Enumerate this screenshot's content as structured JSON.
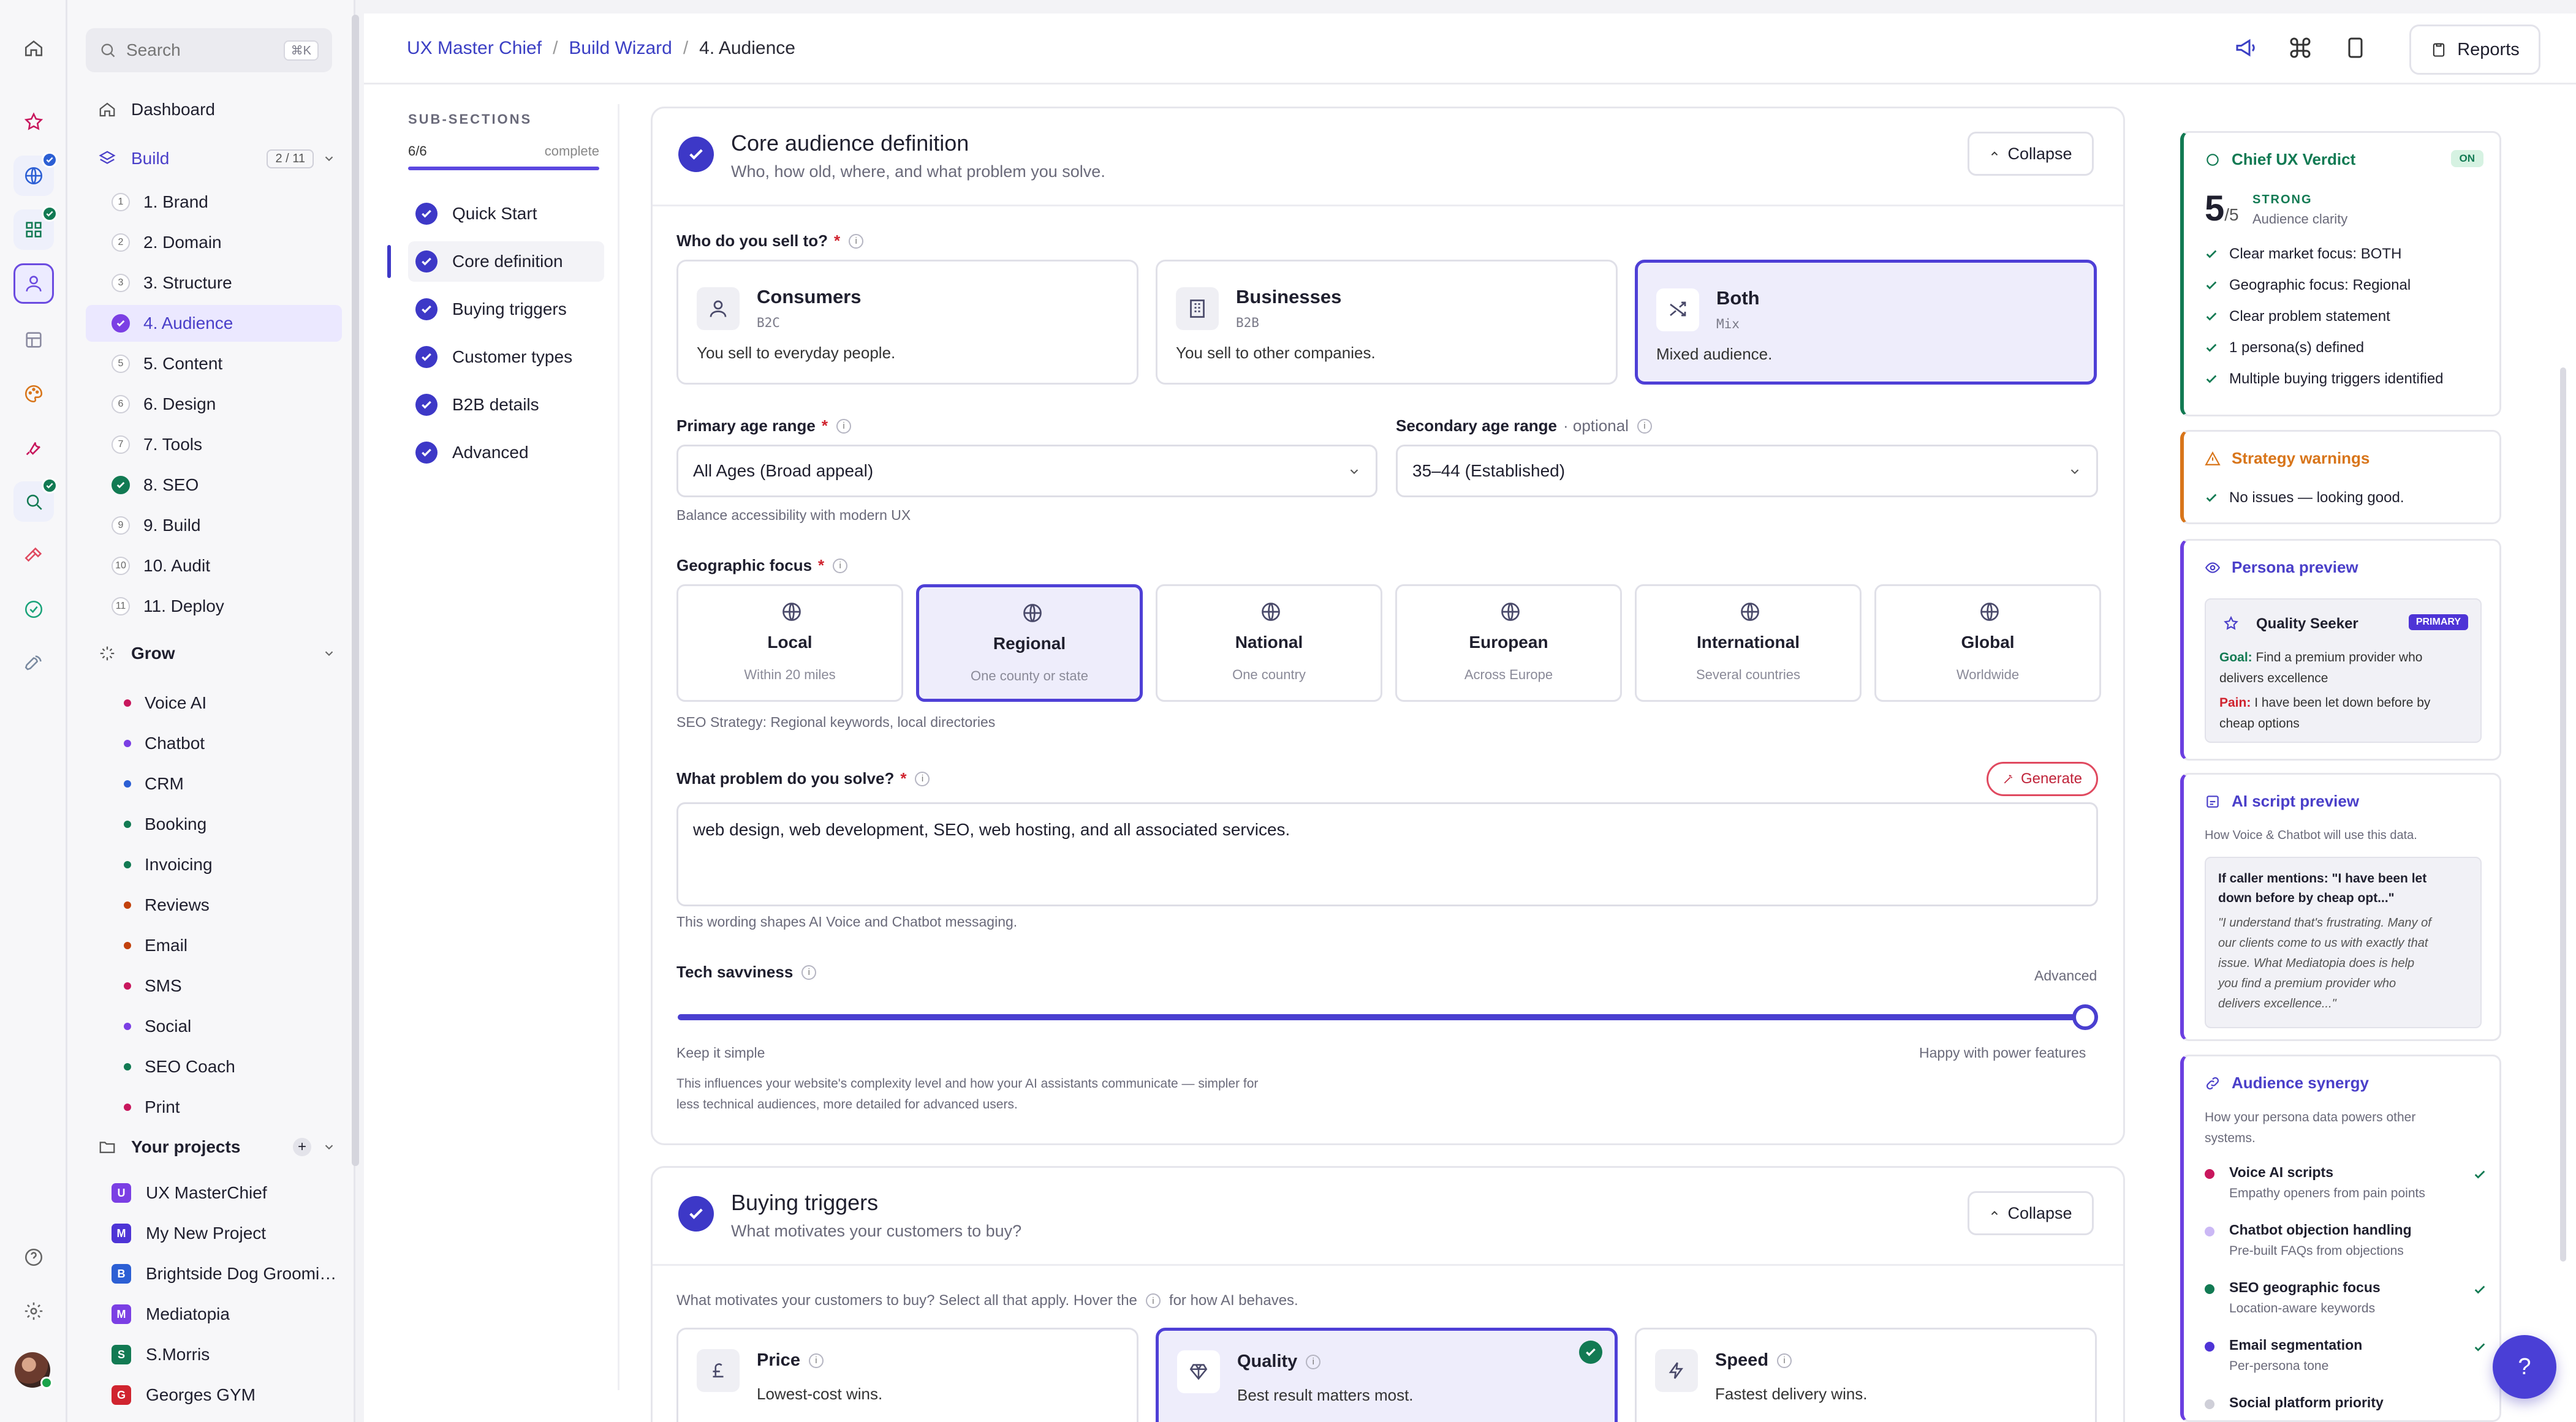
{
  "sidebar": {
    "search_placeholder": "Search",
    "search_shortcut": "⌘K",
    "dashboard": "Dashboard",
    "build_label": "Build",
    "build_progress": "2 / 11",
    "build_steps": [
      "1. Brand",
      "2. Domain",
      "3. Structure",
      "4. Audience",
      "5. Content",
      "6. Design",
      "7. Tools",
      "8. SEO",
      "9. Build",
      "10. Audit",
      "11. Deploy"
    ],
    "step_numbers": [
      "1",
      "2",
      "3",
      "4",
      "5",
      "6",
      "7",
      "8",
      "9",
      "10",
      "11"
    ],
    "grow_label": "Grow",
    "grow_items": [
      "Voice AI",
      "Chatbot",
      "CRM",
      "Booking",
      "Invoicing",
      "Reviews",
      "Email",
      "SMS",
      "Social",
      "SEO Coach",
      "Print"
    ],
    "grow_colors": [
      "#c8175d",
      "#7b3fe4",
      "#2c5fd4",
      "#127a53",
      "#127a53",
      "#c2410c",
      "#c2410c",
      "#c8175d",
      "#7b3fe4",
      "#127a53",
      "#c8175d"
    ],
    "projects_label": "Your projects",
    "projects": [
      {
        "initial": "U",
        "name": "UX MasterChief",
        "color": "#7b3fe4"
      },
      {
        "initial": "M",
        "name": "My New Project",
        "color": "#4e34d6"
      },
      {
        "initial": "B",
        "name": "Brightside Dog Groomi…",
        "color": "#2c5fd4"
      },
      {
        "initial": "M",
        "name": "Mediatopia",
        "color": "#7b3fe4"
      },
      {
        "initial": "S",
        "name": "S.Morris",
        "color": "#127a53"
      },
      {
        "initial": "G",
        "name": "Georges GYM",
        "color": "#d0242f"
      }
    ]
  },
  "topbar": {
    "breadcrumb": [
      "UX Master Chief",
      "Build Wizard",
      "4. Audience"
    ],
    "reports_label": "Reports"
  },
  "subsections": {
    "title": "SUB-SECTIONS",
    "progress": "6/6",
    "complete_label": "complete",
    "items": [
      "Quick Start",
      "Core definition",
      "Buying triggers",
      "Customer types",
      "B2B details",
      "Advanced"
    ]
  },
  "core": {
    "title": "Core audience definition",
    "subtitle": "Who, how old, where, and what problem you solve.",
    "collapse_label": "Collapse",
    "sell_label": "Who do you sell to?",
    "sell_options": [
      {
        "title": "Consumers",
        "code": "B2C",
        "desc": "You sell to everyday people."
      },
      {
        "title": "Businesses",
        "code": "B2B",
        "desc": "You sell to other companies."
      },
      {
        "title": "Both",
        "code": "Mix",
        "desc": "Mixed audience."
      }
    ],
    "primary_age_label": "Primary age range",
    "primary_age_value": "All Ages (Broad appeal)",
    "primary_age_helper": "Balance accessibility with modern UX",
    "secondary_age_label": "Secondary age range",
    "secondary_age_optional": "· optional",
    "secondary_age_value": "35–44 (Established)",
    "geo_label": "Geographic focus",
    "geo_options": [
      {
        "title": "Local",
        "sub": "Within 20 miles"
      },
      {
        "title": "Regional",
        "sub": "One county or state"
      },
      {
        "title": "National",
        "sub": "One country"
      },
      {
        "title": "European",
        "sub": "Across Europe"
      },
      {
        "title": "International",
        "sub": "Several countries"
      },
      {
        "title": "Global",
        "sub": "Worldwide"
      }
    ],
    "geo_helper": "SEO Strategy: Regional keywords, local directories",
    "problem_label": "What problem do you solve?",
    "generate_label": "Generate",
    "problem_value": "web design, web development, SEO, web hosting, and all associated services.",
    "problem_helper": "This wording shapes AI Voice and Chatbot messaging.",
    "tech_label": "Tech savviness",
    "tech_level": "Advanced",
    "tech_value": 1.0,
    "tech_min": "Keep it simple",
    "tech_max": "Happy with power features",
    "tech_helper_1": "This influences your website's complexity level and how your AI assistants communicate — simpler for",
    "tech_helper_2": "less technical audiences, more detailed for advanced users."
  },
  "triggers": {
    "title": "Buying triggers",
    "subtitle": "What motivates your customers to buy?",
    "collapse_label": "Collapse",
    "intro_1": "What motivates your customers to buy? Select all that apply. Hover the",
    "intro_2": "for how AI behaves.",
    "options": [
      {
        "title": "Price",
        "desc": "Lowest-cost wins."
      },
      {
        "title": "Quality",
        "desc": "Best result matters most."
      },
      {
        "title": "Speed",
        "desc": "Fastest delivery wins."
      }
    ]
  },
  "verdict": {
    "title": "Chief UX Verdict",
    "status": "ON",
    "score": "5",
    "score_max": "/5",
    "grade": "STRONG",
    "grade_sub": "Audience clarity",
    "checks": [
      "Clear market focus: BOTH",
      "Geographic focus: Regional",
      "Clear problem statement",
      "1 persona(s) defined",
      "Multiple buying triggers identified"
    ]
  },
  "warnings": {
    "title": "Strategy warnings",
    "text": "No issues — looking good."
  },
  "persona": {
    "title": "Persona preview",
    "name": "Quality Seeker",
    "badge": "PRIMARY",
    "goal_label": "Goal:",
    "goal_1": "Find a premium provider who",
    "goal_2": "delivers excellence",
    "pain_label": "Pain:",
    "pain_1": "I have been let down before by",
    "pain_2": "cheap options"
  },
  "script": {
    "title": "AI script preview",
    "sub": "How Voice & Chatbot will use this data.",
    "head_1": "If caller mentions: \"I have been let",
    "head_2": "down before by cheap opt...\"",
    "body": [
      "\"I understand that's frustrating. Many of",
      "our clients come to us with exactly that",
      "issue. What Mediatopia does is help",
      "you find a premium provider who",
      "delivers excellence...\""
    ]
  },
  "synergy": {
    "title": "Audience synergy",
    "sub_1": "How your persona data powers other",
    "sub_2": "systems.",
    "items": [
      {
        "title": "Voice AI scripts",
        "sub": "Empathy openers from pain points",
        "color": "#c8175d",
        "checked": true
      },
      {
        "title": "Chatbot objection handling",
        "sub": "Pre-built FAQs from objections",
        "color": "#cbb8f5",
        "checked": false
      },
      {
        "title": "SEO geographic focus",
        "sub": "Location-aware keywords",
        "color": "#127a53",
        "checked": true
      },
      {
        "title": "Email segmentation",
        "sub": "Per-persona tone",
        "color": "#4e34d6",
        "checked": true
      },
      {
        "title": "Social platform priority",
        "sub": "",
        "color": "#cfcfd8",
        "checked": false
      }
    ]
  },
  "help_label": "?"
}
